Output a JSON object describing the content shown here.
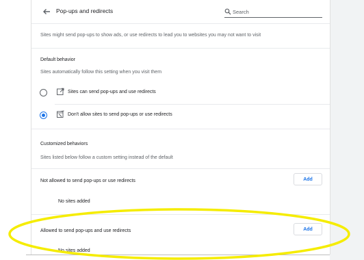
{
  "header": {
    "title": "Pop-ups and redirects",
    "search_placeholder": "Search"
  },
  "description": "Sites might send pop-ups to show ads, or use redirects to lead you to websites you may not want to visit",
  "default_behavior": {
    "heading": "Default behavior",
    "subtitle": "Sites automatically follow this setting when you visit them",
    "options": [
      {
        "label": "Sites can send pop-ups and use redirects",
        "icon": "open-in-new-icon",
        "checked": false
      },
      {
        "label": "Don't allow sites to send pop-ups or use redirects",
        "icon": "popup-blocked-icon",
        "checked": true
      }
    ]
  },
  "customized_behaviors": {
    "heading": "Customized behaviors",
    "subtitle": "Sites listed below follow a custom setting instead of the default",
    "sections": [
      {
        "label": "Not allowed to send pop-ups or use redirects",
        "add_label": "Add",
        "empty_text": "No sites added"
      },
      {
        "label": "Allowed to send pop-ups and use redirects",
        "add_label": "Add",
        "empty_text": "No sites added"
      }
    ]
  },
  "colors": {
    "accent": "#1a73e8",
    "highlight": "#f5ec00",
    "text_primary": "#202124",
    "text_secondary": "#5f6368"
  }
}
